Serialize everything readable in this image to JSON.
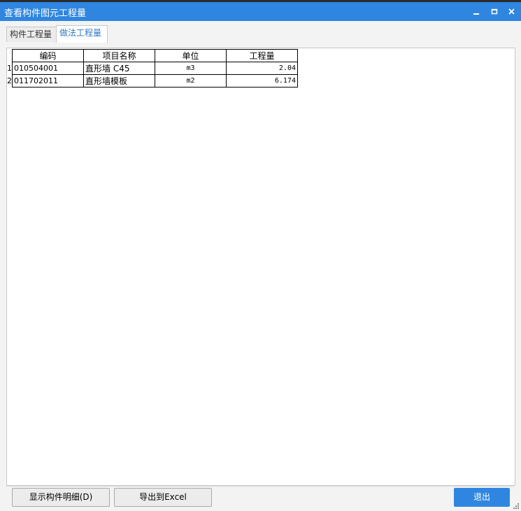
{
  "window": {
    "title": "查看构件图元工程量"
  },
  "tabs": [
    {
      "label": "构件工程量",
      "active": false
    },
    {
      "label": "做法工程量",
      "active": true
    }
  ],
  "table": {
    "headers": [
      "编码",
      "项目名称",
      "单位",
      "工程量"
    ],
    "rows": [
      {
        "num": "1",
        "code": "010504001",
        "name": "直形墙 C45",
        "unit": "m3",
        "qty": "2.04"
      },
      {
        "num": "2",
        "code": "011702011",
        "name": "直形墙模板",
        "unit": "m2",
        "qty": "6.174"
      }
    ]
  },
  "buttons": {
    "show_detail": "显示构件明细(D)",
    "export_excel": "导出到Excel",
    "exit": "退出"
  },
  "colors": {
    "titlebar": "#2f86e0",
    "active_tab_text": "#2f79c8"
  }
}
